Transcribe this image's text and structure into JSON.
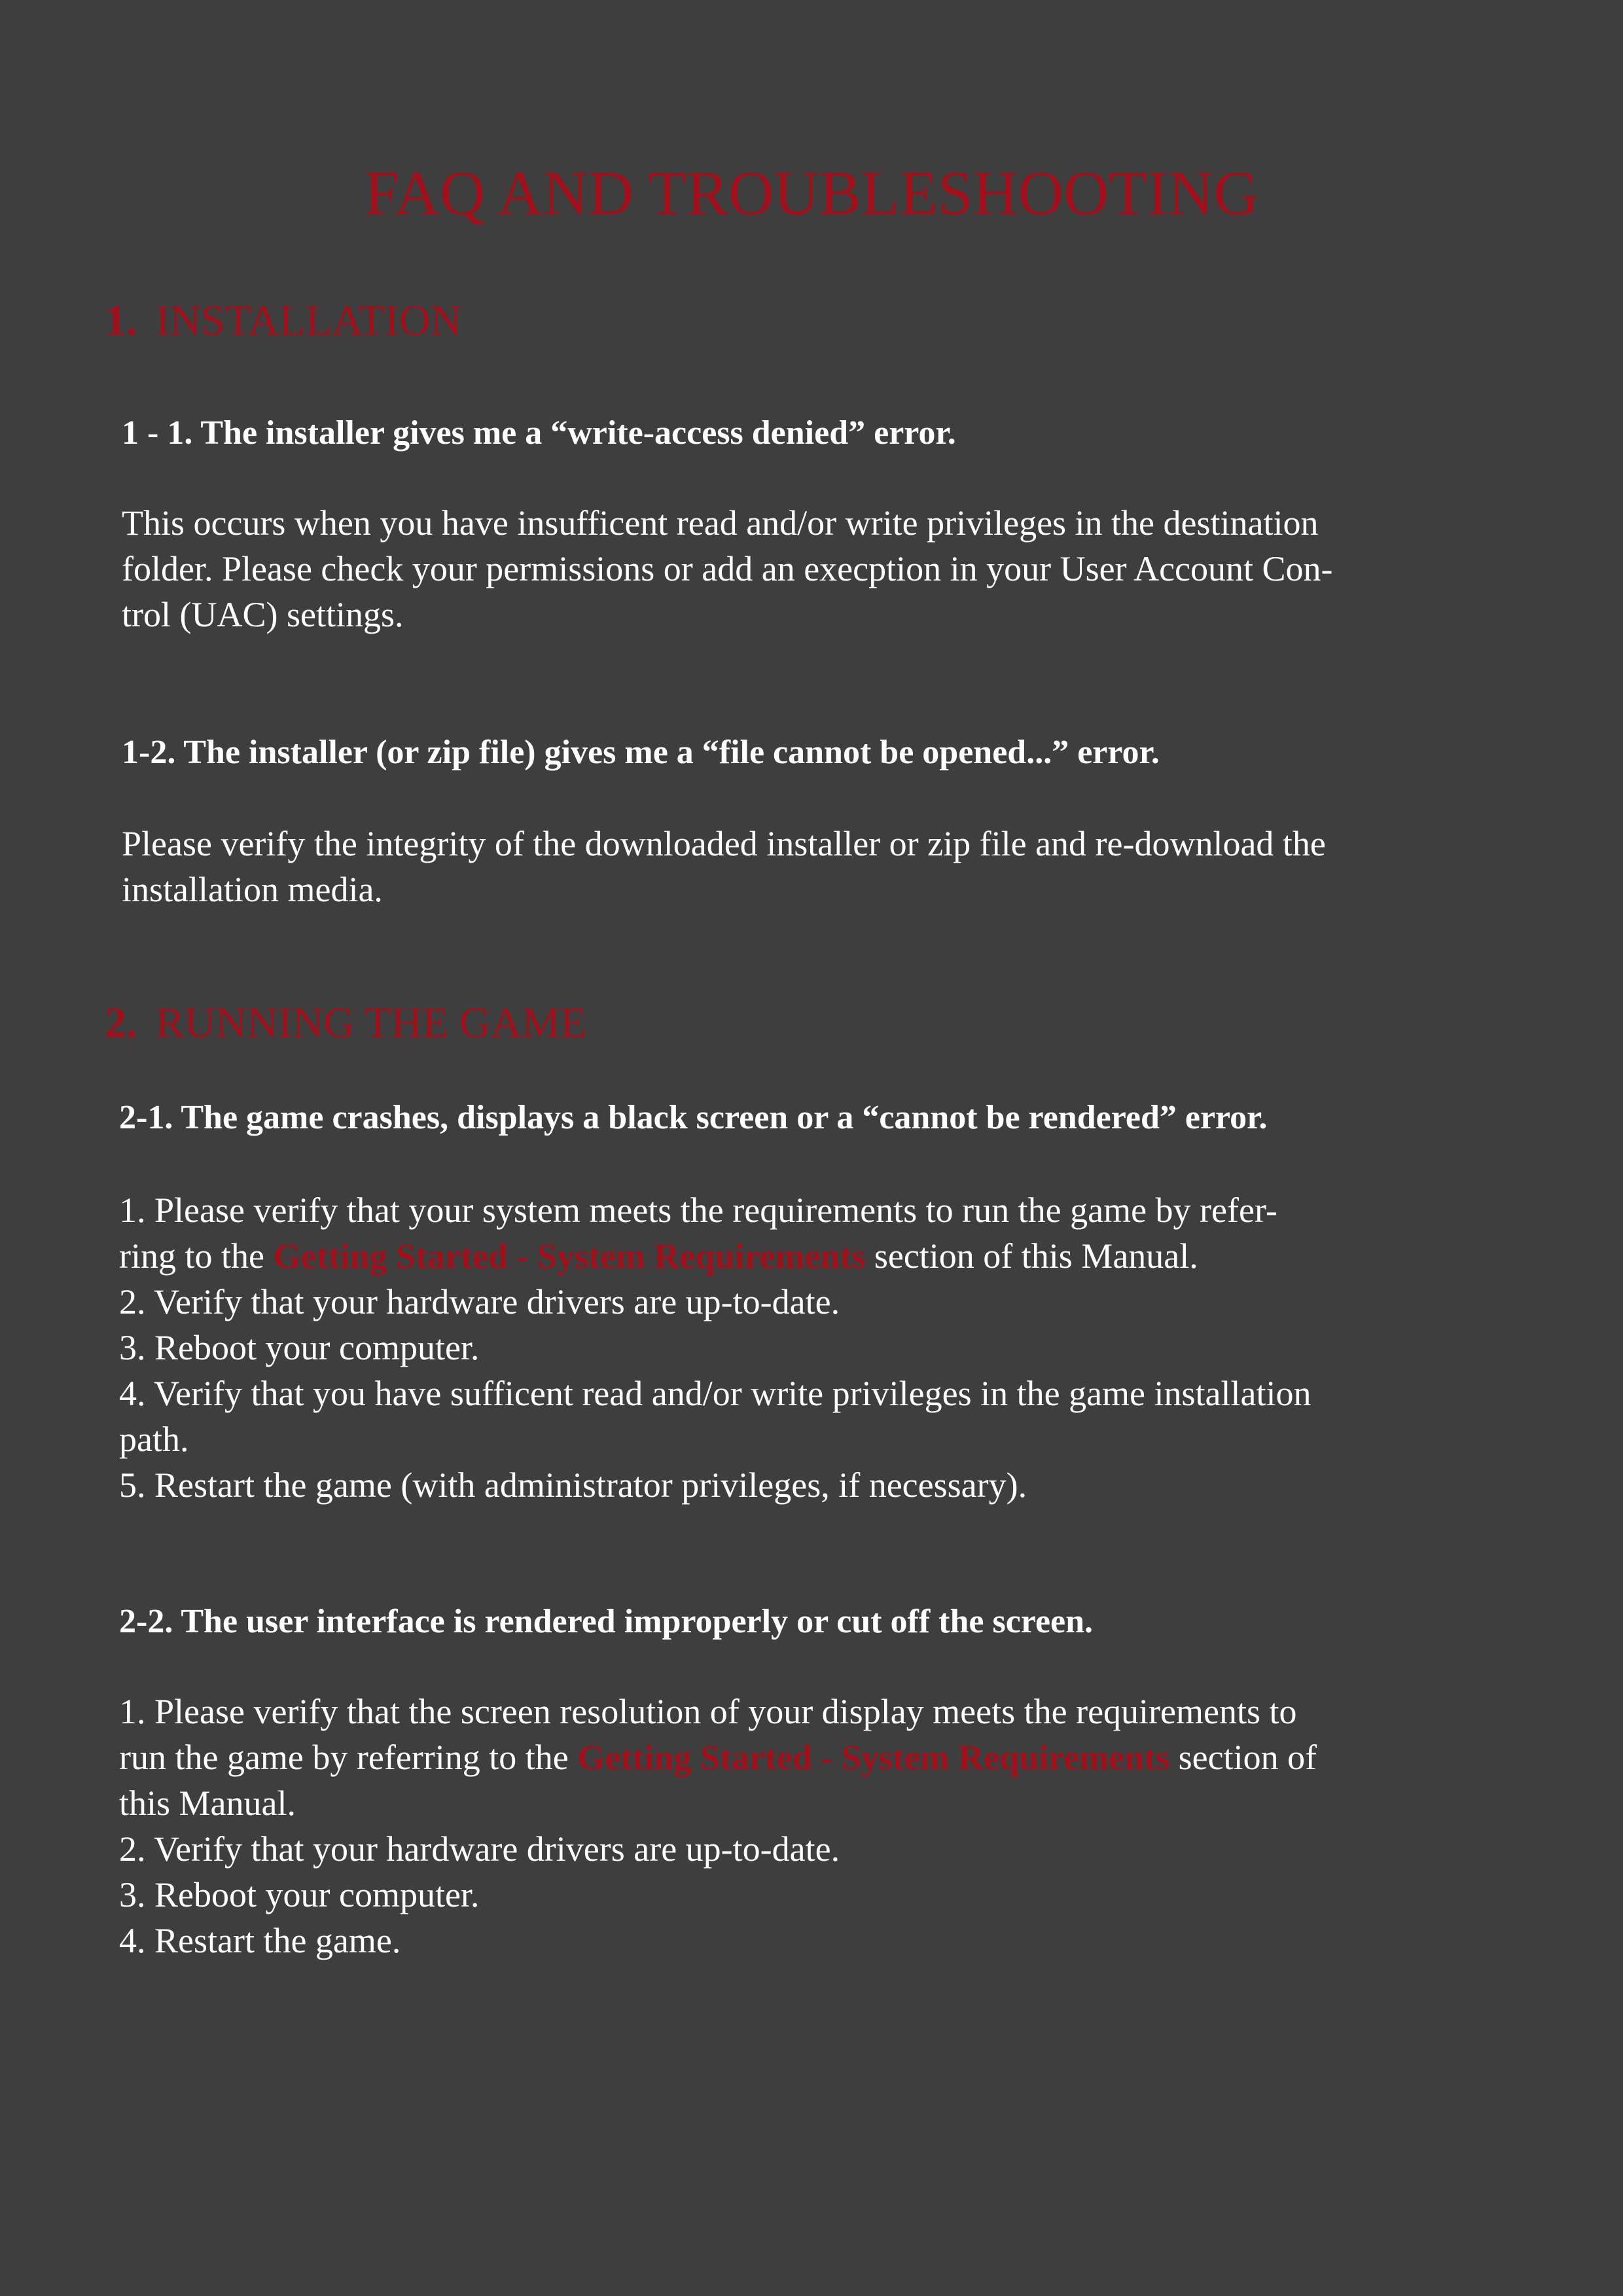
{
  "title": "FAQ AND TROUBLESHOOTING",
  "colors": {
    "background": "#3e3e3e",
    "accent": "#a0101a",
    "text": "#ffffff"
  },
  "sections": [
    {
      "number": "1.",
      "title": "INSTALLATION",
      "questions": [
        {
          "heading": "1 - 1.  The installer gives me a “write-access denied” error.",
          "body_lines": [
            "This occurs when you have insufficent read and/or write privileges in the destination",
            "folder. Please check your permissions or add an execption in your User Account Con-",
            "trol (UAC) settings."
          ]
        },
        {
          "heading": "1-2.  The installer (or zip file) gives me a “file cannot be opened...” error.",
          "body_lines": [
            "Please verify the integrity of the downloaded installer or zip file and re-download the",
            "installation media."
          ]
        }
      ]
    },
    {
      "number": "2.",
      "title": "RUNNING THE GAME",
      "questions": [
        {
          "heading": "2-1.  The game crashes, displays a black screen or a “cannot be rendered” error.",
          "lines": [
            {
              "pre": "1.  Please verify that your system meets the requirements to run the game by refer-",
              "link": "",
              "post": ""
            },
            {
              "pre": "ring to the ",
              "link": "Getting Started - System Requirements",
              "post": " section of this Manual."
            },
            {
              "pre": "2.  Verify that your hardware drivers are up-to-date.",
              "link": "",
              "post": ""
            },
            {
              "pre": "3.  Reboot your computer.",
              "link": "",
              "post": ""
            },
            {
              "pre": "4.  Verify that you have sufficent read and/or write privileges in the game installation",
              "link": "",
              "post": ""
            },
            {
              "pre": "path.",
              "link": "",
              "post": ""
            },
            {
              "pre": "5.  Restart the game (with administrator privileges, if necessary).",
              "link": "",
              "post": ""
            }
          ]
        },
        {
          "heading": "2-2.  The user interface is rendered improperly or cut off the screen.",
          "lines": [
            {
              "pre": "1.  Please verify that the screen resolution of your display meets the requirements to",
              "link": "",
              "post": ""
            },
            {
              "pre": "run the game by referring to the ",
              "link": "Getting Started - System Requirements",
              "post": " section of"
            },
            {
              "pre": "this Manual.",
              "link": "",
              "post": ""
            },
            {
              "pre": "2.  Verify that your hardware drivers are up-to-date.",
              "link": "",
              "post": ""
            },
            {
              "pre": "3.  Reboot your computer.",
              "link": "",
              "post": ""
            },
            {
              "pre": "4.  Restart the game.",
              "link": "",
              "post": ""
            }
          ]
        }
      ]
    }
  ]
}
